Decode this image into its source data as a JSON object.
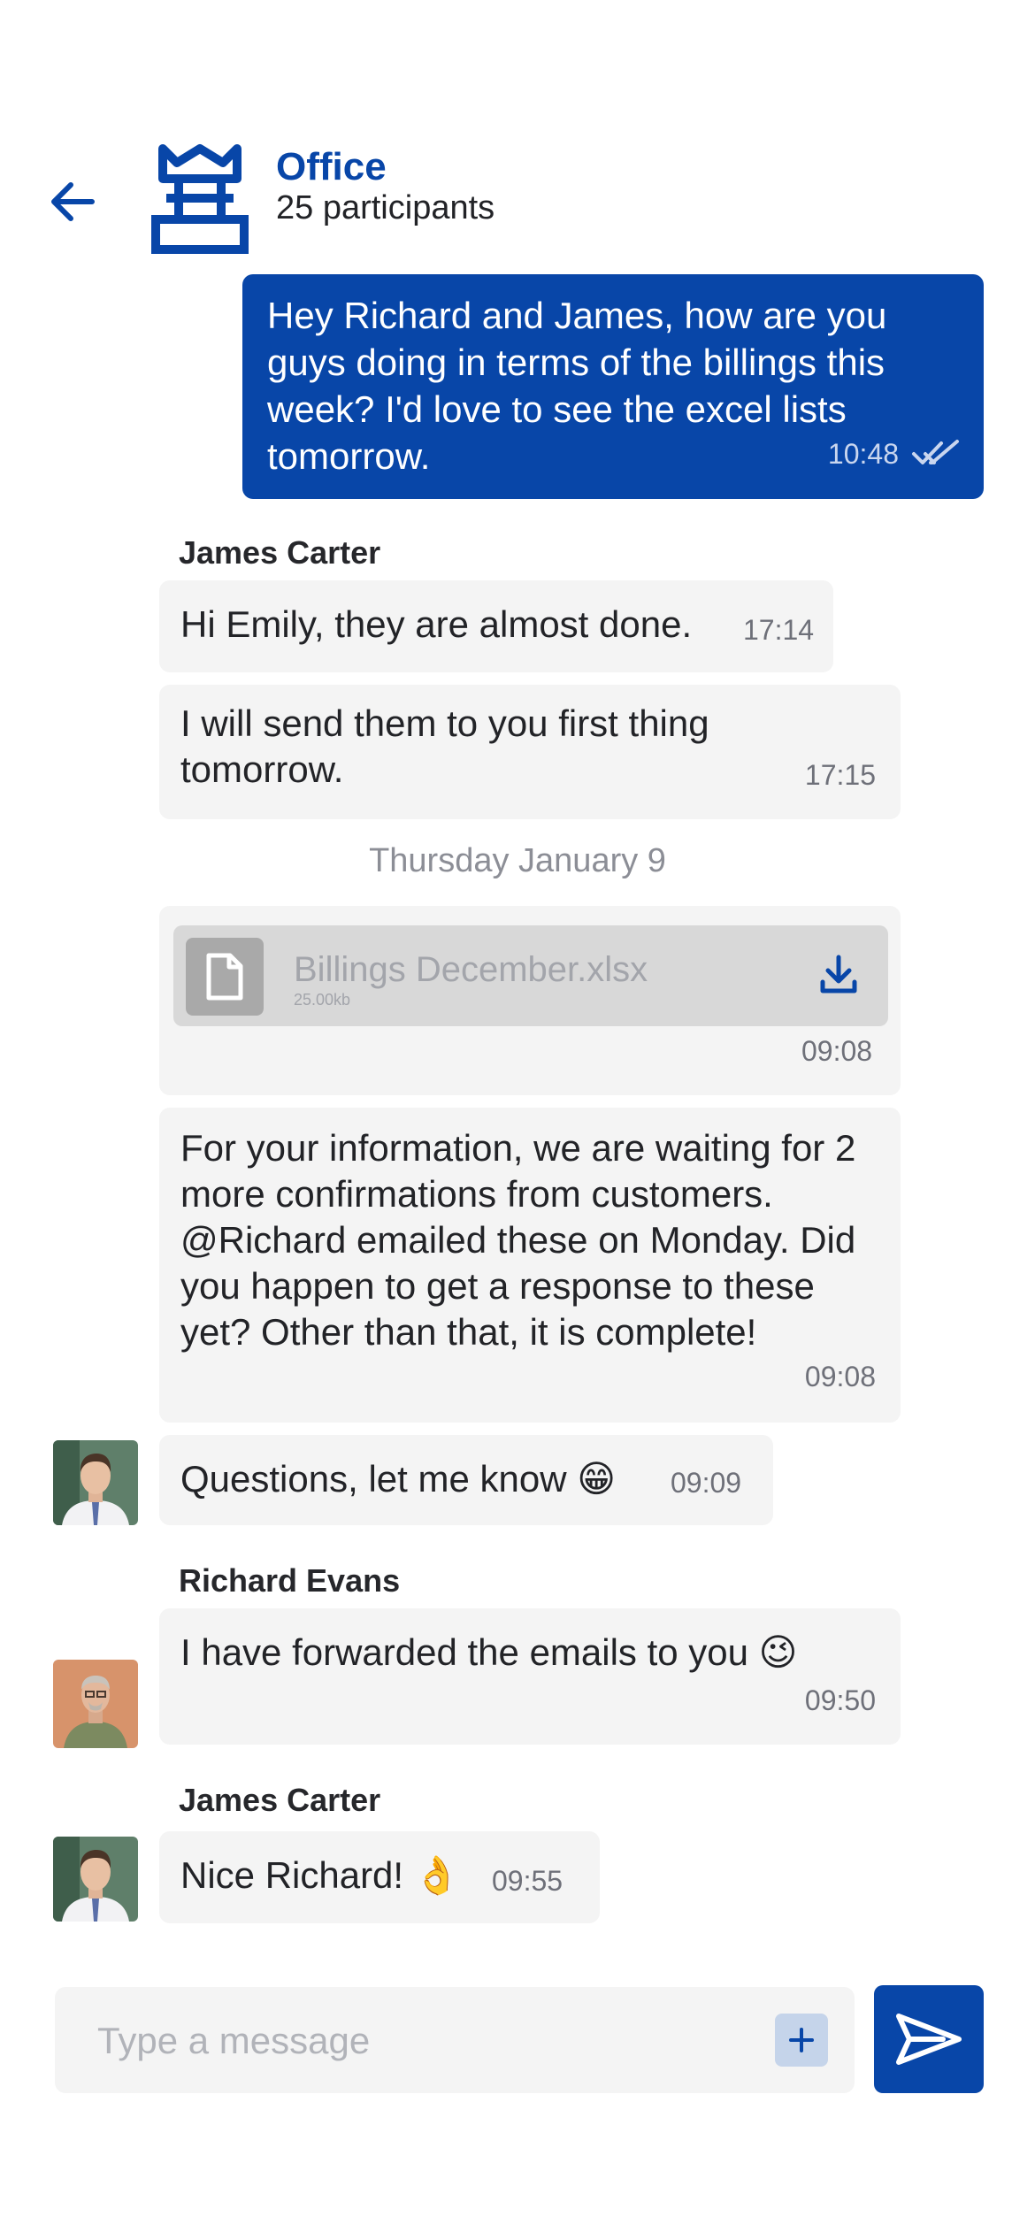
{
  "header": {
    "title": "Office",
    "subtitle": "25 participants"
  },
  "messages": {
    "outgoing": {
      "text": "Hey Richard and James, how are you guys doing in terms of the billings this week? I'd love to see the excel lists tomorrow.",
      "time": "10:48",
      "status": "read"
    },
    "james1": {
      "sender": "James Carter",
      "msg1_text": "Hi Emily, they are almost done.",
      "msg1_time": "17:14",
      "msg2_text": "I will send them to you first thing tomorrow.",
      "msg2_time": "17:15"
    },
    "date_separator": "Thursday January 9",
    "file": {
      "name": "Billings December.xlsx",
      "size": "25.00kb",
      "time": "09:08"
    },
    "info": {
      "text": "For your information, we are waiting for 2 more confirmations from customers. @Richard emailed these on Monday. Did you happen to get a response to these yet? Other than that, it is complete!",
      "time": "09:08"
    },
    "questions": {
      "text": "Questions, let me know 😁",
      "time": "09:09"
    },
    "richard": {
      "sender": "Richard Evans",
      "text": "I have forwarded the emails to you 😉",
      "time": "09:50"
    },
    "james2": {
      "sender": "James Carter",
      "text": "Nice Richard! 👌",
      "time": "09:55"
    }
  },
  "composer": {
    "placeholder": "Type a message"
  },
  "colors": {
    "accent": "#0846a8",
    "bubble_incoming": "#f4f4f4",
    "file_card": "#d8d8d8"
  },
  "icons": {
    "back": "arrow-left-icon",
    "group": "crown-group-icon",
    "file": "document-icon",
    "download": "download-icon",
    "add": "plus-icon",
    "send": "send-icon",
    "read": "double-check-icon"
  }
}
